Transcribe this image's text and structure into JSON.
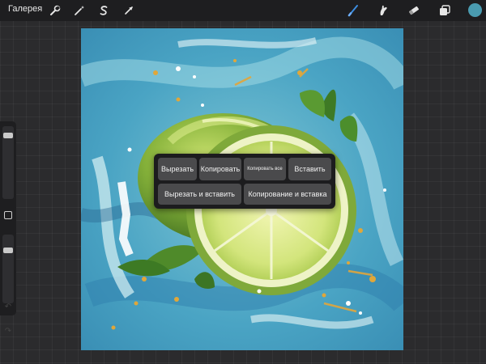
{
  "topbar": {
    "gallery_label": "Галерея",
    "left_tools": [
      {
        "name": "actions",
        "icon": "wrench-icon"
      },
      {
        "name": "adjustments",
        "icon": "magic-wand-icon"
      },
      {
        "name": "selection",
        "icon": "selection-s-icon"
      },
      {
        "name": "transform",
        "icon": "arrow-cursor-icon"
      }
    ],
    "right_tools": [
      {
        "name": "brush",
        "icon": "brush-icon",
        "active": true
      },
      {
        "name": "smudge",
        "icon": "smudge-icon"
      },
      {
        "name": "eraser",
        "icon": "eraser-icon"
      },
      {
        "name": "layers",
        "icon": "layers-icon"
      }
    ],
    "current_color": "#4a9bb0",
    "accent_color": "#3d8de0"
  },
  "sidebar": {
    "brush_size_level": 0.1,
    "opacity_level": 0.2,
    "modify_icon": "square-icon",
    "undo_icon": "undo-arrow-icon",
    "redo_icon": "redo-arrow-icon"
  },
  "popup": {
    "row1": [
      {
        "id": "cut",
        "label": "Вырезать"
      },
      {
        "id": "copy",
        "label": "Копировать"
      },
      {
        "id": "copy-all",
        "label": "Копировать все"
      },
      {
        "id": "paste",
        "label": "Вставить"
      }
    ],
    "row2": [
      {
        "id": "cut-paste",
        "label": "Вырезать и вставить"
      },
      {
        "id": "copy-paste",
        "label": "Копирование и вставка"
      }
    ]
  }
}
